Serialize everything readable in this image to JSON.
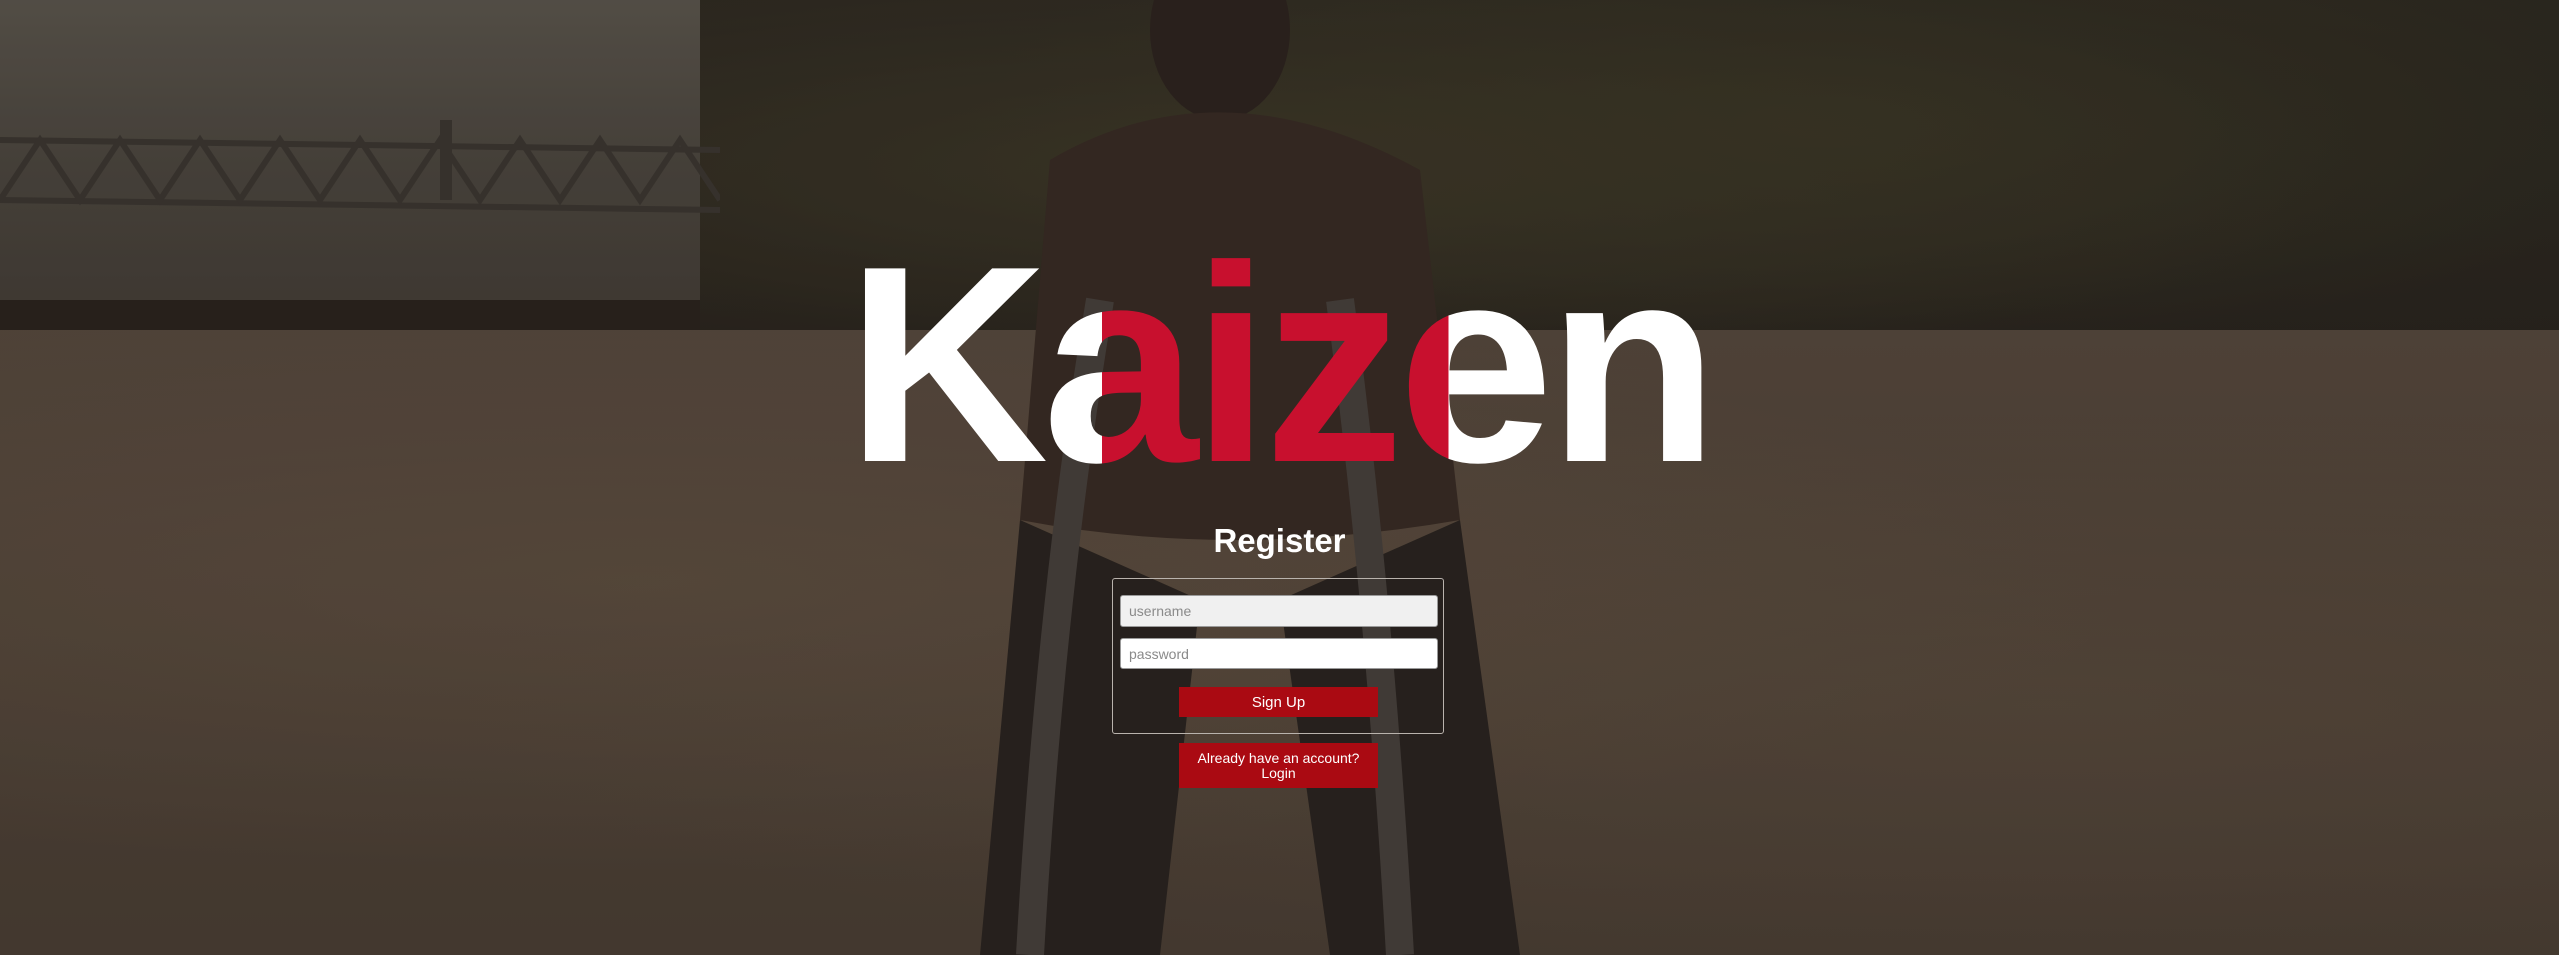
{
  "logo": {
    "text": "Kaizen"
  },
  "register": {
    "heading": "Register",
    "username_placeholder": "username",
    "password_placeholder": "password",
    "signup_label": "Sign Up",
    "login_label": "Already have an account?\nLogin"
  },
  "colors": {
    "accent": "#c8102e",
    "button": "#aa0a12",
    "text": "#ffffff"
  }
}
